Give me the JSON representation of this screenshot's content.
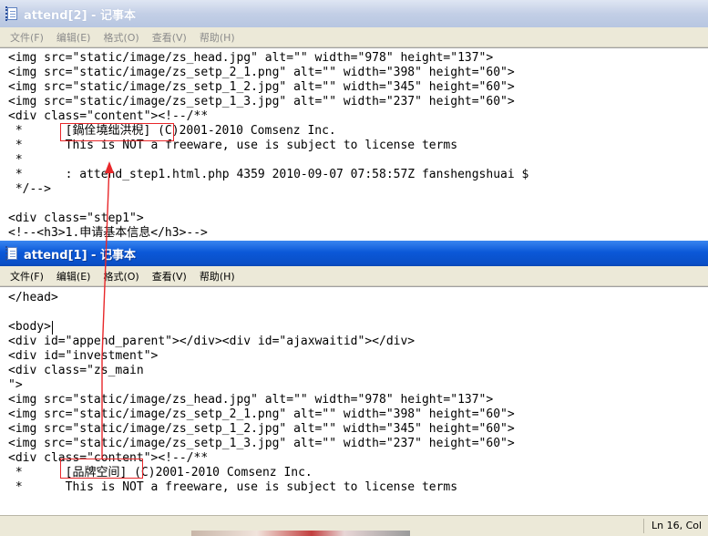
{
  "back_window": {
    "title": "attend[2] - 记事本",
    "menu": [
      "文件(F)",
      "编辑(E)",
      "格式(O)",
      "查看(V)",
      "帮助(H)"
    ],
    "lines": [
      "<img src=\"static/image/zs_head.jpg\" alt=\"\" width=\"978\" height=\"137\">",
      "<img src=\"static/image/zs_setp_2_1.png\" alt=\"\" width=\"398\" height=\"60\">",
      "<img src=\"static/image/zs_setp_1_2.jpg\" alt=\"\" width=\"345\" height=\"60\">",
      "<img src=\"static/image/zs_setp_1_3.jpg\" alt=\"\" width=\"237\" height=\"60\">",
      "<div class=\"content\"><!--/**",
      " *      [鍋佺墝绌洪棿] (C)2001-2010 Comsenz Inc.",
      " *      This is NOT a freeware, use is subject to license terms",
      " *",
      " *      : attend_step1.html.php 4359 2010-09-07 07:58:57Z fanshengshuai $",
      " */-->",
      "",
      "<div class=\"step1\">",
      "<!--<h3>1.申请基本信息</h3>-->"
    ]
  },
  "front_window": {
    "title": "attend[1] - 记事本",
    "menu": [
      "文件(F)",
      "编辑(E)",
      "格式(O)",
      "查看(V)",
      "帮助(H)"
    ],
    "lines": [
      "</head>",
      "",
      "<body>",
      "<div id=\"append_parent\"></div><div id=\"ajaxwaitid\"></div>",
      "<div id=\"investment\">",
      "<div class=\"zs_main",
      "\">",
      "<img src=\"static/image/zs_head.jpg\" alt=\"\" width=\"978\" height=\"137\">",
      "<img src=\"static/image/zs_setp_2_1.png\" alt=\"\" width=\"398\" height=\"60\">",
      "<img src=\"static/image/zs_setp_1_2.jpg\" alt=\"\" width=\"345\" height=\"60\">",
      "<img src=\"static/image/zs_setp_1_3.jpg\" alt=\"\" width=\"237\" height=\"60\">",
      "<div class=\"content\"><!--/**",
      " *      [品牌空间] (C)2001-2010 Comsenz Inc.",
      " *      This is NOT a freeware, use is subject to license terms"
    ],
    "status": {
      "position": "Ln 16, Col"
    }
  },
  "annotation": {
    "color": "#e8272a"
  }
}
